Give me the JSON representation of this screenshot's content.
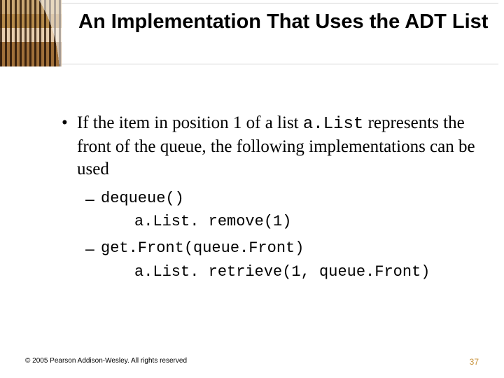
{
  "slide": {
    "title": "An Implementation That Uses the ADT List",
    "bullet": {
      "marker": "•",
      "text_pre": "If the item in position 1 of a list ",
      "code": "a.List",
      "text_post": " represents the front of the queue, the following implementations can be used"
    },
    "subitems": [
      {
        "dash": "–",
        "head": "dequeue()",
        "body": "a.List. remove(1)"
      },
      {
        "dash": "–",
        "head": "get.Front(queue.Front)",
        "body": "a.List. retrieve(1, queue.Front)"
      }
    ],
    "footer": {
      "copyright": "© 2005 Pearson Addison-Wesley. All rights reserved",
      "page": "37"
    }
  }
}
